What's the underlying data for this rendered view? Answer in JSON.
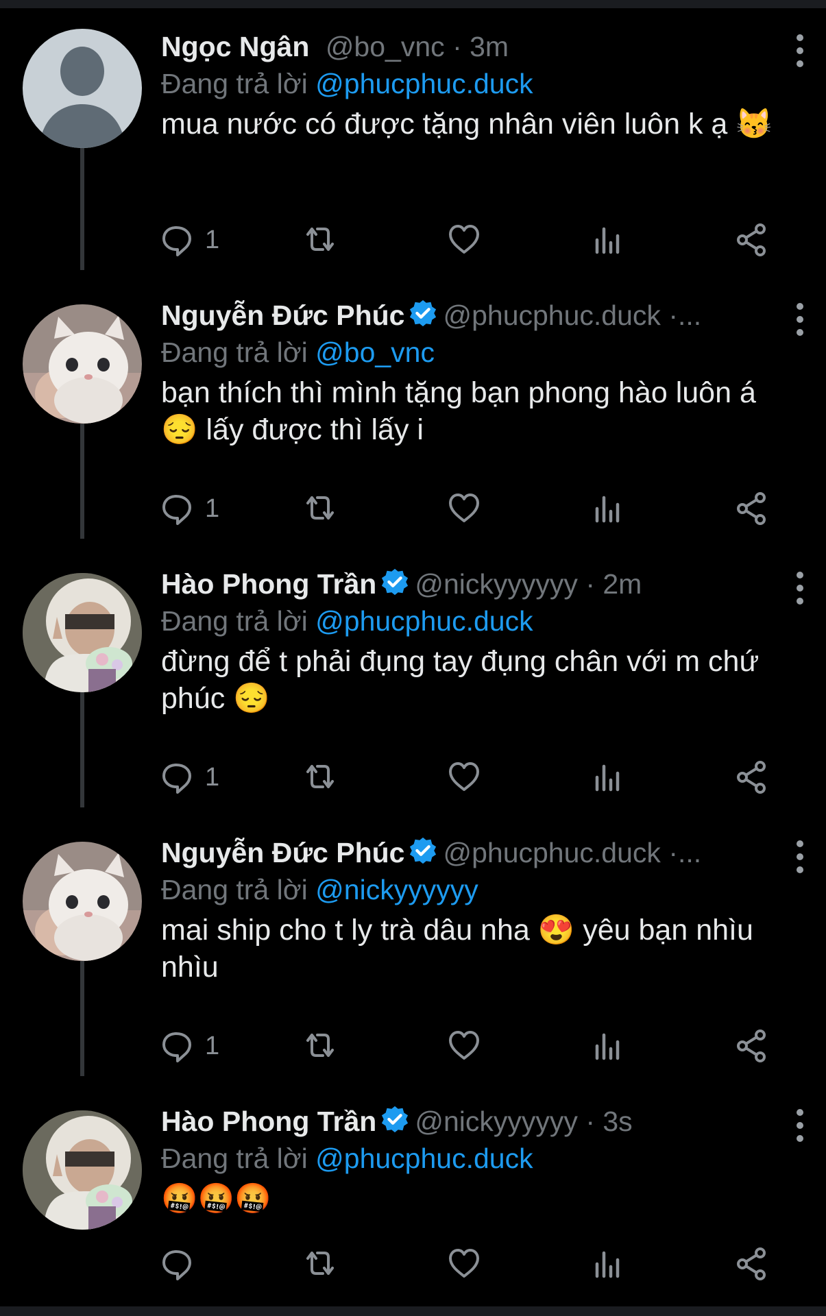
{
  "tweets": [
    {
      "name": "Ngọc Ngân",
      "verified": false,
      "handle": "@bo_vnc",
      "time": "· 3m",
      "replying_prefix": "Đang trả lời",
      "replying_to": "@phucphuc.duck",
      "text": "mua nước có được tặng nhân viên luôn k ạ 😽",
      "reply_count": "1",
      "avatar": "default-avatar-icon"
    },
    {
      "name": "Nguyễn Đức Phúc",
      "verified": true,
      "handle": "@phucphuc.duck",
      "time": "·...",
      "replying_prefix": "Đang trả lời",
      "replying_to": "@bo_vnc",
      "text": "bạn thích thì mình tặng bạn phong hào luôn á 😔 lấy được thì lấy i",
      "reply_count": "1",
      "avatar": "white-cat-photo"
    },
    {
      "name": "Hào Phong Trần",
      "verified": true,
      "handle": "@nickyyyyyy",
      "time": "· 2m",
      "replying_prefix": "Đang trả lời",
      "replying_to": "@phucphuc.duck",
      "text": "đừng để t phải đụng tay đụng chân với m chứ phúc 😔",
      "reply_count": "1",
      "avatar": "hooded-person-photo"
    },
    {
      "name": "Nguyễn Đức Phúc",
      "verified": true,
      "handle": "@phucphuc.duck",
      "time": "·...",
      "replying_prefix": "Đang trả lời",
      "replying_to": "@nickyyyyyy",
      "text": "mai ship cho t ly trà dâu nha 😍 yêu bạn nhìu nhìu",
      "reply_count": "1",
      "avatar": "white-cat-photo"
    },
    {
      "name": "Hào Phong Trần",
      "verified": true,
      "handle": "@nickyyyyyy",
      "time": "· 3s",
      "replying_prefix": "Đang trả lời",
      "replying_to": "@phucphuc.duck",
      "text": "🤬🤬🤬",
      "reply_count": "",
      "avatar": "hooded-person-photo"
    }
  ],
  "colors": {
    "background": "#000000",
    "text": "#e7e9ea",
    "muted": "#71767b",
    "link": "#1d9bf0",
    "verified": "#1d9bf0"
  }
}
